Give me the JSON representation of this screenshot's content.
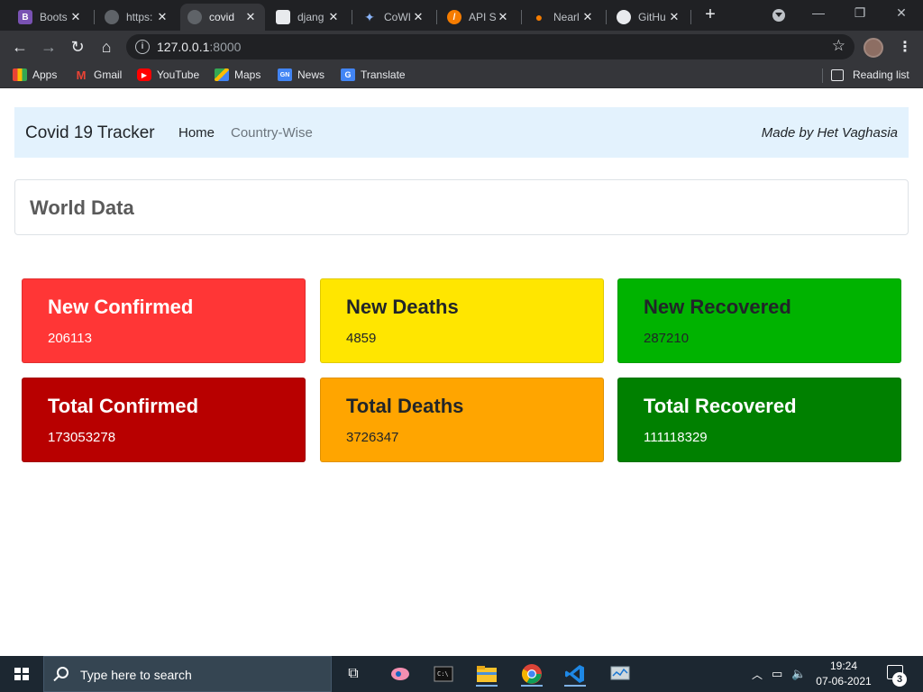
{
  "browser": {
    "tabs": [
      {
        "title": "Boots",
        "favicon": "bootstrap-icon",
        "color": "#7952b3"
      },
      {
        "title": "https:",
        "favicon": "globe-icon",
        "color": "#5f6368"
      },
      {
        "title": "covid",
        "favicon": "globe-icon",
        "color": "#5f6368"
      },
      {
        "title": "djang",
        "favicon": "cube-icon",
        "color": "#e8eaed"
      },
      {
        "title": "CoWI",
        "favicon": "sparkle-icon",
        "color": "#4285f4"
      },
      {
        "title": "API Si",
        "favicon": "api-icon",
        "color": "#f57c00"
      },
      {
        "title": "Nearl",
        "favicon": "location-pin-icon",
        "color": "#f57c00"
      },
      {
        "title": "GitHu",
        "favicon": "github-icon",
        "color": "#e8eaed"
      }
    ],
    "active_tab_index": 2,
    "url_host": "127.0.0.1",
    "url_port": ":8000",
    "bookmarks": [
      {
        "label": "Apps",
        "icon": "apps-grid-icon"
      },
      {
        "label": "Gmail",
        "icon": "gmail-icon"
      },
      {
        "label": "YouTube",
        "icon": "youtube-icon"
      },
      {
        "label": "Maps",
        "icon": "maps-icon"
      },
      {
        "label": "News",
        "icon": "news-icon"
      },
      {
        "label": "Translate",
        "icon": "translate-icon"
      }
    ],
    "reading_list": "Reading list"
  },
  "site": {
    "brand": "Covid 19 Tracker",
    "nav": {
      "home": "Home",
      "country": "Country-Wise"
    },
    "made_by": "Made by Het Vaghasia",
    "section_title": "World Data",
    "stats": [
      {
        "label": "New Confirmed",
        "value": "206113",
        "color": "#ff3636"
      },
      {
        "label": "New Deaths",
        "value": "4859",
        "color": "#ffe600"
      },
      {
        "label": "New Recovered",
        "value": "287210",
        "color": "#00b300"
      },
      {
        "label": "Total Confirmed",
        "value": "173053278",
        "color": "#b80000"
      },
      {
        "label": "Total Deaths",
        "value": "3726347",
        "color": "#ffa500"
      },
      {
        "label": "Total Recovered",
        "value": "111118329",
        "color": "#008000"
      }
    ]
  },
  "taskbar": {
    "search_placeholder": "Type here to search",
    "time": "19:24",
    "date": "07-06-2021",
    "notification_count": "3"
  }
}
